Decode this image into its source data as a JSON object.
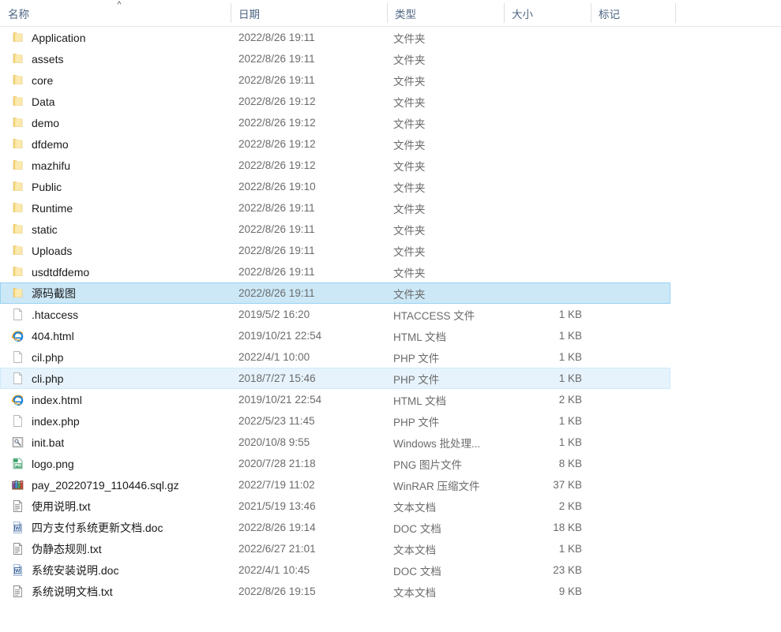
{
  "window": {
    "type": "file-explorer-details-view",
    "sort": {
      "column": "名称",
      "direction": "ascending",
      "glyph": "^"
    }
  },
  "columns": [
    {
      "key": "name",
      "label": "名称"
    },
    {
      "key": "date",
      "label": "日期"
    },
    {
      "key": "type",
      "label": "类型"
    },
    {
      "key": "size",
      "label": "大小"
    },
    {
      "key": "tags",
      "label": "标记"
    }
  ],
  "colors": {
    "selection_fill": "#cce8f7",
    "selection_border": "#99d1f2",
    "hover_fill": "#e6f3fc",
    "header_text": "#4d6582",
    "secondary_text": "#6b6b6b",
    "folder_icon": "#fbe08a"
  },
  "rows": [
    {
      "icon": "folder-icon",
      "name": "Application",
      "date": "2022/8/26 19:11",
      "type": "文件夹",
      "size": "",
      "tags": "",
      "state": "normal"
    },
    {
      "icon": "folder-icon",
      "name": "assets",
      "date": "2022/8/26 19:11",
      "type": "文件夹",
      "size": "",
      "tags": "",
      "state": "normal"
    },
    {
      "icon": "folder-icon",
      "name": "core",
      "date": "2022/8/26 19:11",
      "type": "文件夹",
      "size": "",
      "tags": "",
      "state": "normal"
    },
    {
      "icon": "folder-icon",
      "name": "Data",
      "date": "2022/8/26 19:12",
      "type": "文件夹",
      "size": "",
      "tags": "",
      "state": "normal"
    },
    {
      "icon": "folder-icon",
      "name": "demo",
      "date": "2022/8/26 19:12",
      "type": "文件夹",
      "size": "",
      "tags": "",
      "state": "normal"
    },
    {
      "icon": "folder-icon",
      "name": "dfdemo",
      "date": "2022/8/26 19:12",
      "type": "文件夹",
      "size": "",
      "tags": "",
      "state": "normal"
    },
    {
      "icon": "folder-icon",
      "name": "mazhifu",
      "date": "2022/8/26 19:12",
      "type": "文件夹",
      "size": "",
      "tags": "",
      "state": "normal"
    },
    {
      "icon": "folder-icon",
      "name": "Public",
      "date": "2022/8/26 19:10",
      "type": "文件夹",
      "size": "",
      "tags": "",
      "state": "normal"
    },
    {
      "icon": "folder-icon",
      "name": "Runtime",
      "date": "2022/8/26 19:11",
      "type": "文件夹",
      "size": "",
      "tags": "",
      "state": "normal"
    },
    {
      "icon": "folder-icon",
      "name": "static",
      "date": "2022/8/26 19:11",
      "type": "文件夹",
      "size": "",
      "tags": "",
      "state": "normal"
    },
    {
      "icon": "folder-icon",
      "name": "Uploads",
      "date": "2022/8/26 19:11",
      "type": "文件夹",
      "size": "",
      "tags": "",
      "state": "normal"
    },
    {
      "icon": "folder-icon",
      "name": "usdtdfdemo",
      "date": "2022/8/26 19:11",
      "type": "文件夹",
      "size": "",
      "tags": "",
      "state": "normal"
    },
    {
      "icon": "folder-icon",
      "name": "源码截图",
      "date": "2022/8/26 19:11",
      "type": "文件夹",
      "size": "",
      "tags": "",
      "state": "selected"
    },
    {
      "icon": "blank-file-icon",
      "name": ".htaccess",
      "date": "2019/5/2 16:20",
      "type": "HTACCESS 文件",
      "size": "1 KB",
      "tags": "",
      "state": "normal"
    },
    {
      "icon": "internet-explorer-icon",
      "name": "404.html",
      "date": "2019/10/21 22:54",
      "type": "HTML 文档",
      "size": "1 KB",
      "tags": "",
      "state": "normal"
    },
    {
      "icon": "blank-file-icon",
      "name": "cil.php",
      "date": "2022/4/1 10:00",
      "type": "PHP 文件",
      "size": "1 KB",
      "tags": "",
      "state": "normal"
    },
    {
      "icon": "blank-file-icon",
      "name": "cli.php",
      "date": "2018/7/27 15:46",
      "type": "PHP 文件",
      "size": "1 KB",
      "tags": "",
      "state": "hover"
    },
    {
      "icon": "internet-explorer-icon",
      "name": "index.html",
      "date": "2019/10/21 22:54",
      "type": "HTML 文档",
      "size": "2 KB",
      "tags": "",
      "state": "normal"
    },
    {
      "icon": "blank-file-icon",
      "name": "index.php",
      "date": "2022/5/23 11:45",
      "type": "PHP 文件",
      "size": "1 KB",
      "tags": "",
      "state": "normal"
    },
    {
      "icon": "batch-file-icon",
      "name": "init.bat",
      "date": "2020/10/8 9:55",
      "type": "Windows 批处理...",
      "size": "1 KB",
      "tags": "",
      "state": "normal"
    },
    {
      "icon": "image-file-icon",
      "name": "logo.png",
      "date": "2020/7/28 21:18",
      "type": "PNG 图片文件",
      "size": "8 KB",
      "tags": "",
      "state": "normal"
    },
    {
      "icon": "winrar-archive-icon",
      "name": "pay_20220719_110446.sql.gz",
      "date": "2022/7/19 11:02",
      "type": "WinRAR 压缩文件",
      "size": "37 KB",
      "tags": "",
      "state": "normal"
    },
    {
      "icon": "text-document-icon",
      "name": "使用说明.txt",
      "date": "2021/5/19 13:46",
      "type": "文本文档",
      "size": "2 KB",
      "tags": "",
      "state": "normal"
    },
    {
      "icon": "word-document-icon",
      "name": "四方支付系统更新文档.doc",
      "date": "2022/8/26 19:14",
      "type": "DOC 文档",
      "size": "18 KB",
      "tags": "",
      "state": "normal"
    },
    {
      "icon": "text-document-icon",
      "name": "伪静态规则.txt",
      "date": "2022/6/27 21:01",
      "type": "文本文档",
      "size": "1 KB",
      "tags": "",
      "state": "normal"
    },
    {
      "icon": "word-document-icon",
      "name": "系统安装说明.doc",
      "date": "2022/4/1 10:45",
      "type": "DOC 文档",
      "size": "23 KB",
      "tags": "",
      "state": "normal"
    },
    {
      "icon": "text-document-icon",
      "name": "系统说明文档.txt",
      "date": "2022/8/26 19:15",
      "type": "文本文档",
      "size": "9 KB",
      "tags": "",
      "state": "normal"
    }
  ]
}
